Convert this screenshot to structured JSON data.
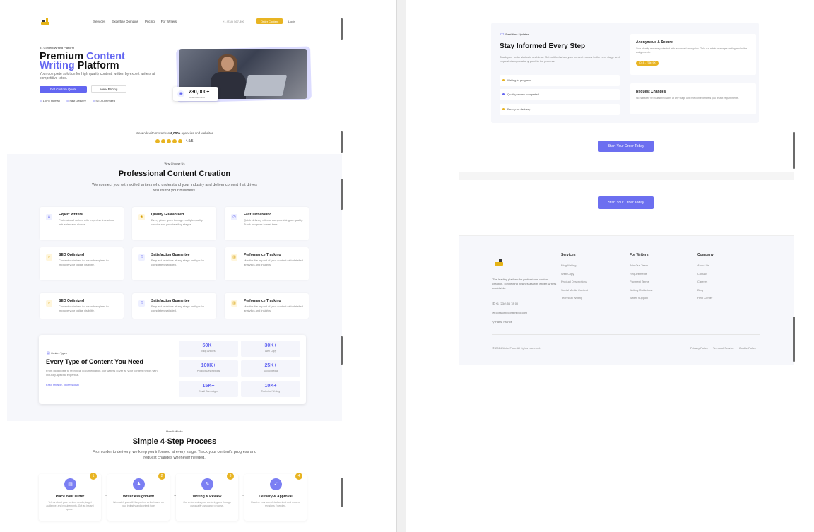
{
  "nav": {
    "links": [
      "Services",
      "Expertise Domains",
      "Pricing",
      "For Writers"
    ],
    "phone": "+1 (234) 567-890",
    "cta": "Order Content",
    "login": "Login"
  },
  "hero": {
    "tag": "#1 Content Writing Platform",
    "title_part1": "Premium ",
    "title_accent1": "Content",
    "title_accent2": "Writing",
    "title_part2": " Platform",
    "subtitle": "Your complete solution for high quality content, written by expert writers at competitive rates.",
    "btn_primary": "Get Custom Quote",
    "btn_secondary": "View Pricing",
    "features": [
      "100% Human",
      "Fast Delivery",
      "SEO Optimized"
    ],
    "stat_number": "230,000+",
    "stat_label": "content delivered"
  },
  "trust": {
    "text_pre": "We work with more than ",
    "text_bold": "6,000+",
    "text_post": " agencies and websites",
    "rating": "4.9/5"
  },
  "section_creation": {
    "kicker": "Why Choose Us",
    "title": "Professional Content Creation",
    "subtitle": "We connect you with skilled writers who understand your industry and deliver content that drives results for your business.",
    "features": [
      {
        "title": "Expert Writers",
        "desc": "Professional writers with expertise in various industries and niches."
      },
      {
        "title": "Quality Guaranteed",
        "desc": "Every piece goes through multiple quality checks and proofreading stages."
      },
      {
        "title": "Fast Turnaround",
        "desc": "Quick delivery without compromising on quality. Track progress in real-time."
      },
      {
        "title": "SEO Optimized",
        "desc": "Content optimized for search engines to improve your online visibility."
      },
      {
        "title": "Satisfaction Guarantee",
        "desc": "Request revisions at any stage until you're completely satisfied."
      },
      {
        "title": "Performance Tracking",
        "desc": "Monitor the impact of your content with detailed analytics and insights."
      },
      {
        "title": "SEO Optimized",
        "desc": "Content optimized for search engines to improve your online visibility."
      },
      {
        "title": "Satisfaction Guarantee",
        "desc": "Request revisions at any stage until you're completely satisfied."
      },
      {
        "title": "Performance Tracking",
        "desc": "Monitor the impact of your content with detailed analytics and insights."
      }
    ]
  },
  "content_types": {
    "kicker": "Content Types",
    "title": "Every Type of Content You Need",
    "desc": "From blog posts to technical documentation, our writers cover all your content needs with industry-specific expertise.",
    "link": "Fast, reliable, professional",
    "stats": [
      {
        "n": "50K+",
        "l": "Blog Articles"
      },
      {
        "n": "30K+",
        "l": "Web Copy"
      },
      {
        "n": "100K+",
        "l": "Product Descriptions"
      },
      {
        "n": "25K+",
        "l": "Social Media"
      },
      {
        "n": "15K+",
        "l": "Email Campaigns"
      },
      {
        "n": "10K+",
        "l": "Technical Writing"
      }
    ]
  },
  "process": {
    "kicker": "How It Works",
    "title": "Simple 4-Step Process",
    "subtitle": "From order to delivery, we keep you informed at every stage. Track your content's progress and request changes whenever needed.",
    "steps": [
      {
        "n": "1",
        "title": "Place Your Order",
        "desc": "Tell us about your content needs, target audience, and requirements. Get an instant quote."
      },
      {
        "n": "2",
        "title": "Writer Assignment",
        "desc": "We match you with the perfect writer based on your industry and content type."
      },
      {
        "n": "3",
        "title": "Writing & Review",
        "desc": "Our writer crafts your content, goes through our quality assurance process."
      },
      {
        "n": "4",
        "title": "Delivery & Approval",
        "desc": "Receive your completed content and request revisions if needed."
      }
    ]
  },
  "tracking": {
    "kicker": "Real-time Updates",
    "title": "Stay Informed Every Step",
    "desc": "Track your order status in real-time. Get notified when your content moves to the next stage and request changes at any point in the process.",
    "statuses": [
      "Writing in progress...",
      "Quality review completed",
      "Ready for delivery"
    ],
    "anon_title": "Anonymous & Secure",
    "anon_desc": "Your identity remains protected with advanced encryption. Only our admin manages writing and writer assignments.",
    "anon_pill": "ID: 8 - 7366 9X",
    "changes_title": "Request Changes",
    "changes_desc": "Not satisfied? Request revisions at any stage until the content meets your exact requirements."
  },
  "cta": {
    "label1": "Start Your Order Today",
    "label2": "Start Your Order Today"
  },
  "footer": {
    "tagline": "The leading platform for professional content creation, connecting businesses with expert writers worldwide.",
    "phone": "+1 (234) 56 78 00",
    "email": "contact@contentpro.com",
    "location": "Paris, France",
    "col1_title": "Services",
    "col1": [
      "Blog Writing",
      "Web Copy",
      "Product Descriptions",
      "Social Media Content",
      "Technical Writing"
    ],
    "col2_title": "For Writers",
    "col2": [
      "Join Our Team",
      "Requirements",
      "Payment Terms",
      "Writing Guidelines",
      "Writer Support"
    ],
    "col3_title": "Company",
    "col3": [
      "About Us",
      "Contact",
      "Careers",
      "Blog",
      "Help Center"
    ],
    "copyright": "© 2024 Write Flow. All rights reserved.",
    "legal": [
      "Privacy Policy",
      "Terms of Service",
      "Cookie Policy"
    ]
  },
  "colors": {
    "accent": "#6366f1",
    "gold": "#e8b422"
  },
  "icons": [
    "user-icon",
    "shield-icon",
    "clock-icon",
    "search-icon",
    "award-icon",
    "chart-icon",
    "document-icon",
    "edit-icon",
    "check-icon",
    "phone-icon",
    "mail-icon",
    "pin-icon"
  ]
}
